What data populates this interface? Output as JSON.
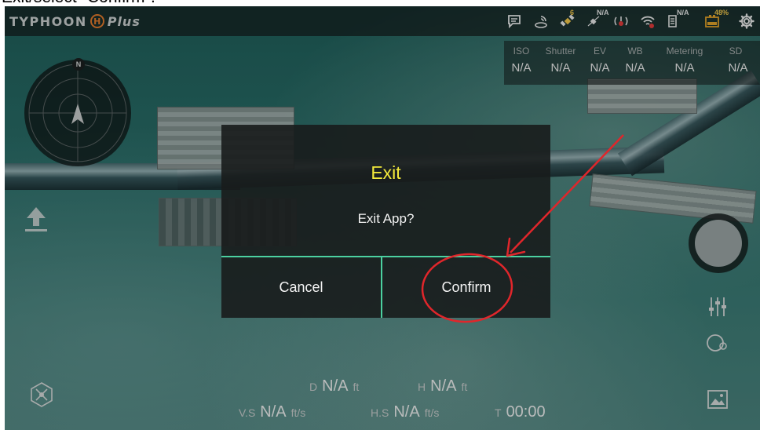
{
  "caption": "Exit/select \"Confirm\".",
  "app": {
    "logo_word": "TYPHOON",
    "logo_badge": "H",
    "logo_suffix": "Plus"
  },
  "status_bar": {
    "satellite_count": "6",
    "controller_signal": "N/A",
    "drone_signal_label": "N/A",
    "battery_percent": "48%",
    "colors": {
      "accent": "#f2c84b",
      "battery": "#e0a22a",
      "signal_warn": "#e23b3b"
    }
  },
  "camera_params": [
    {
      "label": "ISO",
      "value": "N/A"
    },
    {
      "label": "Shutter",
      "value": "N/A"
    },
    {
      "label": "EV",
      "value": "N/A"
    },
    {
      "label": "WB",
      "value": "N/A"
    },
    {
      "label": "Metering",
      "value": "N/A"
    },
    {
      "label": "SD",
      "value": "N/A"
    }
  ],
  "compass": {
    "north_label": "N"
  },
  "telemetry": {
    "distance": {
      "label": "D",
      "value": "N/A",
      "unit": "ft"
    },
    "height": {
      "label": "H",
      "value": "N/A",
      "unit": "ft"
    },
    "vertical_speed": {
      "label": "V.S",
      "value": "N/A",
      "unit": "ft/s"
    },
    "horizontal_speed": {
      "label": "H.S",
      "value": "N/A",
      "unit": "ft/s"
    },
    "flight_time": {
      "label": "T",
      "value": "00:00"
    }
  },
  "dialog": {
    "title": "Exit",
    "message": "Exit App?",
    "cancel_label": "Cancel",
    "confirm_label": "Confirm",
    "title_color": "#f4ea3b",
    "divider_color": "#4bd0a0"
  },
  "annotation": {
    "color": "#e0262b"
  },
  "icons": {
    "top_bar": [
      "chat-icon",
      "rtk-icon",
      "gps-satellite-icon",
      "drone-link-icon",
      "controller-signal-icon",
      "wifi-icon",
      "drone-signal-icon",
      "battery-icon",
      "settings-gear-icon"
    ],
    "left": [
      "compass-icon",
      "takeoff-icon",
      "flight-mode-icon"
    ],
    "right": [
      "shutter-button",
      "camera-settings-icon",
      "camera-mode-icon",
      "gallery-icon"
    ]
  }
}
